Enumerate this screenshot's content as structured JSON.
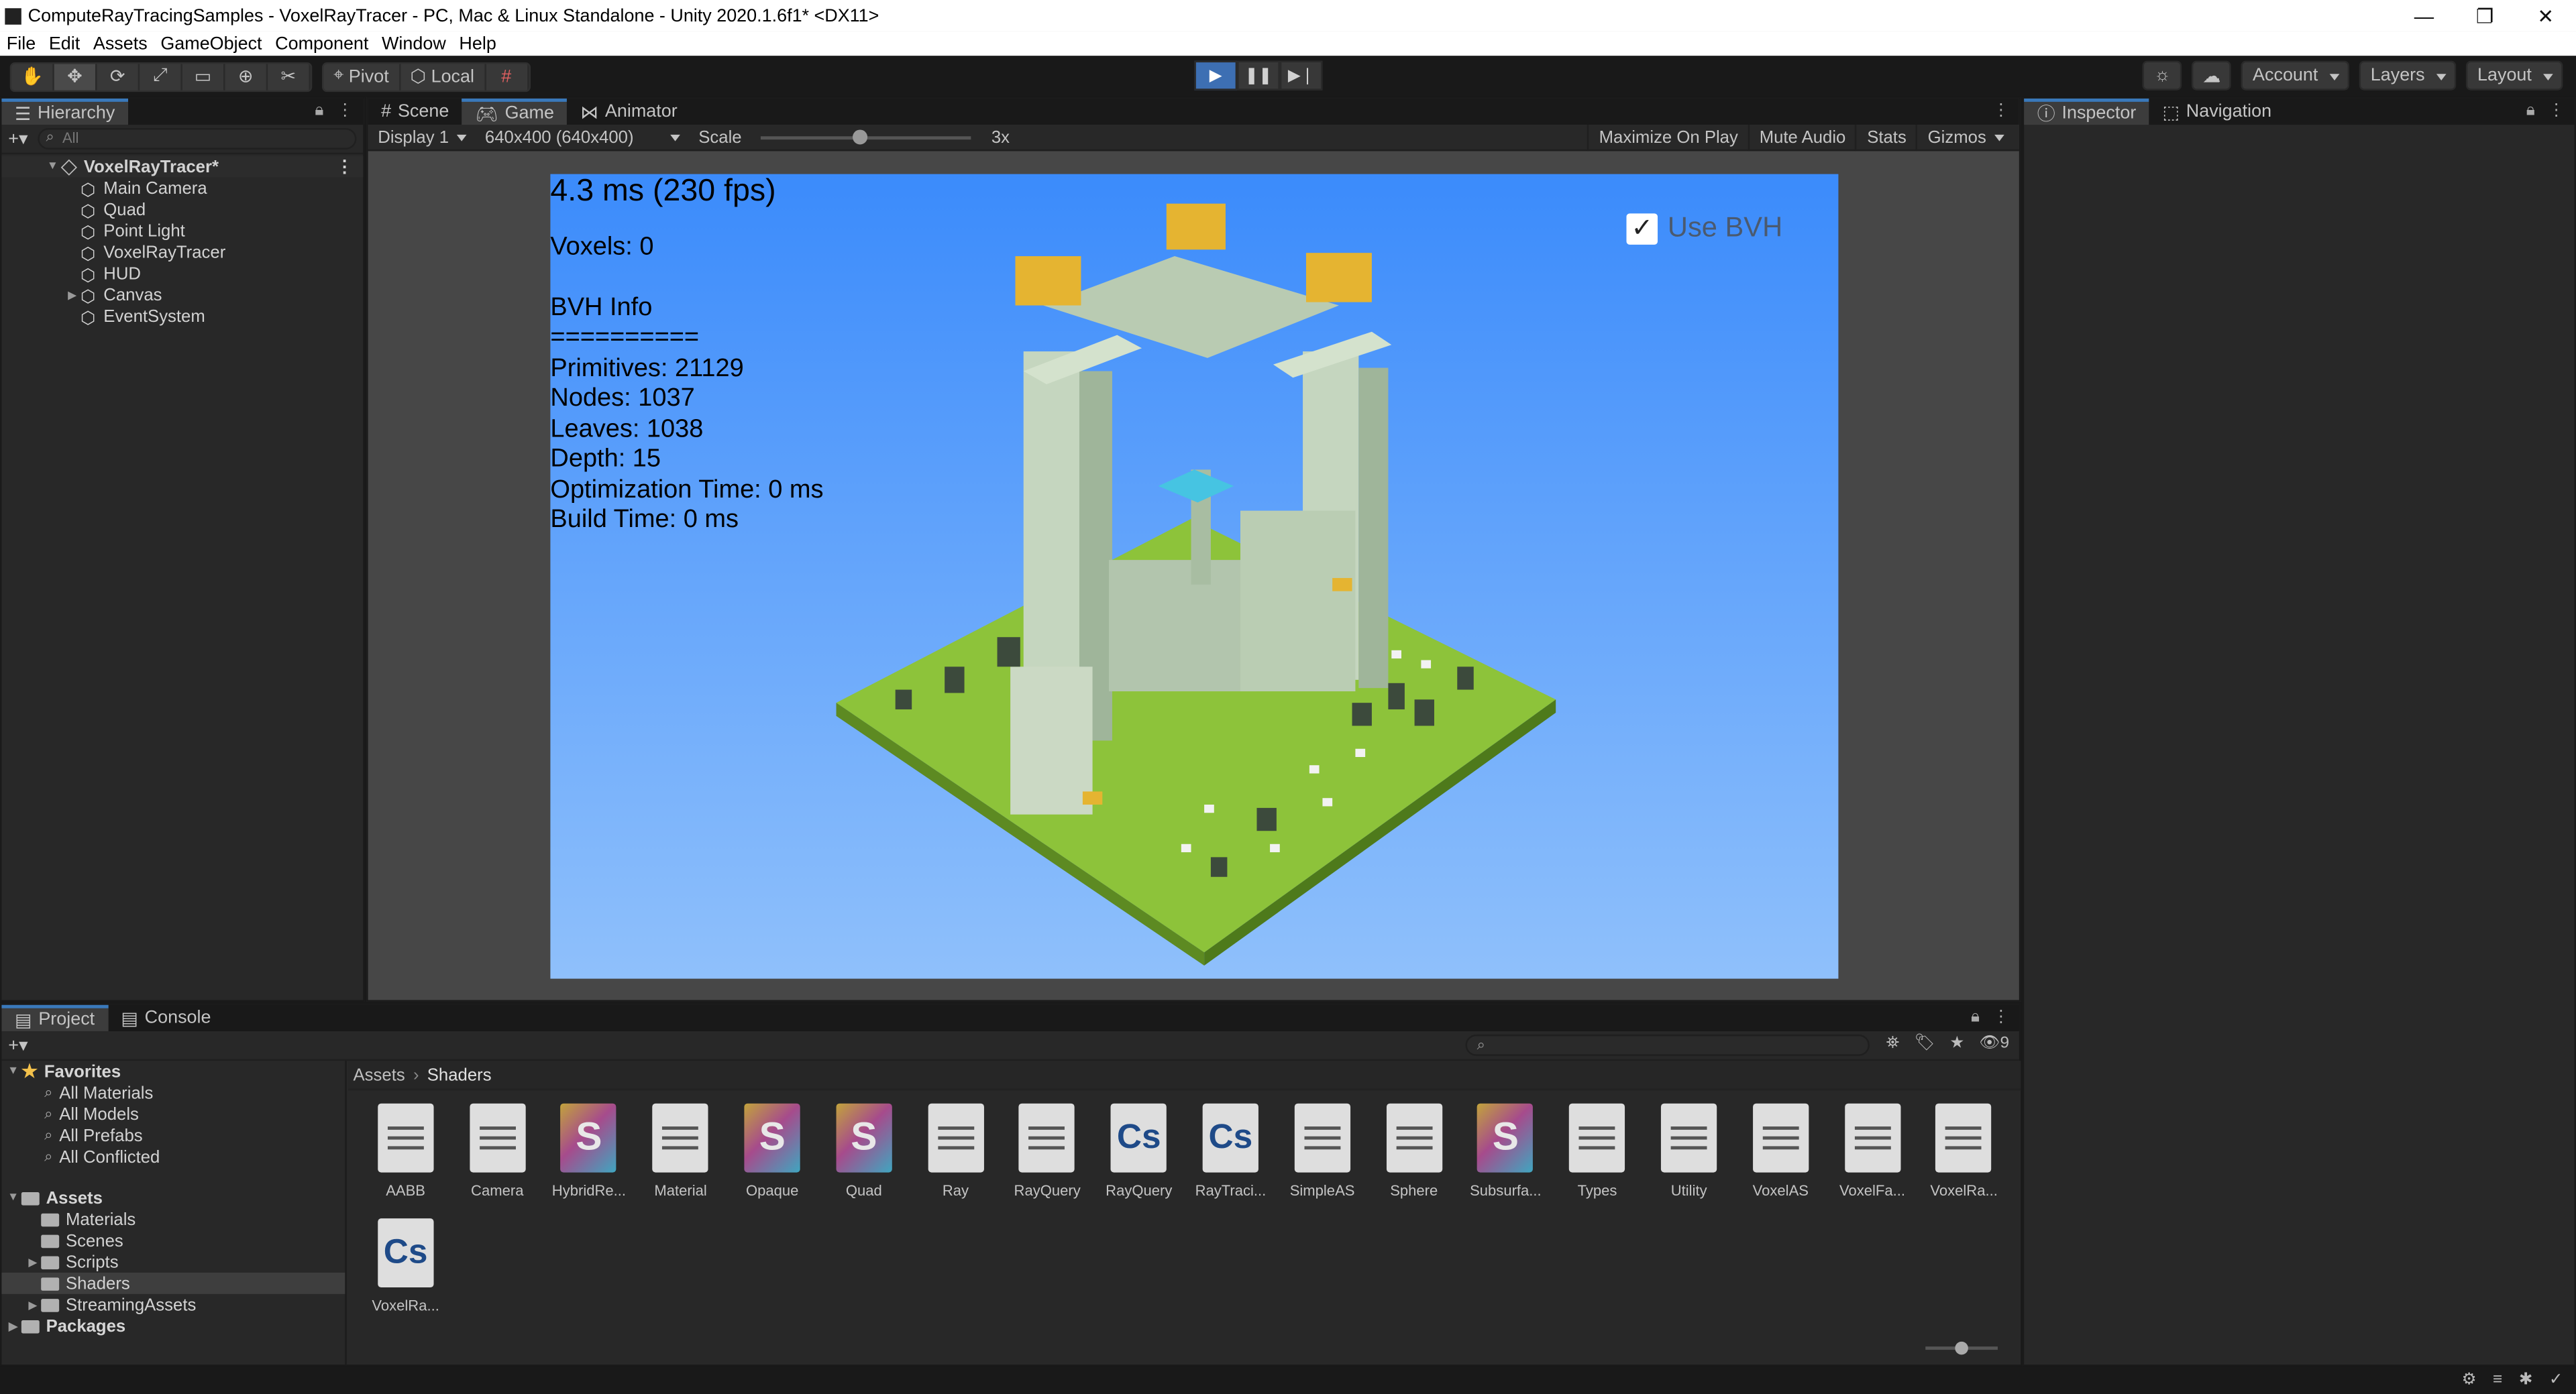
{
  "window": {
    "title": "ComputeRayTracingSamples - VoxelRayTracer - PC, Mac & Linux Standalone - Unity 2020.1.6f1* <DX11>",
    "controls": [
      "—",
      "❐",
      "✕"
    ]
  },
  "menu": [
    "File",
    "Edit",
    "Assets",
    "GameObject",
    "Component",
    "Window",
    "Help"
  ],
  "toolbar": {
    "pivot_label": "Pivot",
    "local_label": "Local",
    "account_label": "Account",
    "layers_label": "Layers",
    "layout_label": "Layout"
  },
  "hierarchy": {
    "tab_label": "Hierarchy",
    "search_placeholder": "All",
    "scene_name": "VoxelRayTracer*",
    "items": [
      "Main Camera",
      "Quad",
      "Point Light",
      "VoxelRayTracer",
      "HUD",
      "Canvas",
      "EventSystem"
    ]
  },
  "center_tabs": [
    "Scene",
    "Game",
    "Animator"
  ],
  "game_toolbar": {
    "display": "Display 1",
    "resolution": "640x400 (640x400)",
    "scale_label": "Scale",
    "scale_value": "3x",
    "maximize": "Maximize On Play",
    "mute": "Mute Audio",
    "stats": "Stats",
    "gizmos": "Gizmos"
  },
  "hud": {
    "fps": "4.3 ms (230 fps)",
    "voxels": "Voxels: 0",
    "bvh_title": "BVH Info",
    "divider": "==========",
    "primitives": "Primitives: 21129",
    "nodes": "Nodes: 1037",
    "leaves": "Leaves: 1038",
    "depth": "Depth: 15",
    "opt_time": "Optimization Time: 0 ms",
    "build_time": "Build Time: 0 ms",
    "use_bvh_label": "Use BVH",
    "use_bvh_checked": true
  },
  "right_tabs": [
    "Inspector",
    "Navigation"
  ],
  "bottom_tabs": [
    "Project",
    "Console"
  ],
  "project": {
    "hidden_count": "9",
    "favorites_label": "Favorites",
    "favorites": [
      "All Materials",
      "All Models",
      "All Prefabs",
      "All Conflicted"
    ],
    "assets_label": "Assets",
    "asset_folders": [
      "Materials",
      "Scenes",
      "Scripts",
      "Shaders",
      "StreamingAssets"
    ],
    "packages_label": "Packages",
    "breadcrumb": [
      "Assets",
      "Shaders"
    ],
    "files": [
      {
        "name": "AABB",
        "kind": "doc"
      },
      {
        "name": "Camera",
        "kind": "doc"
      },
      {
        "name": "HybridRe...",
        "kind": "shader"
      },
      {
        "name": "Material",
        "kind": "doc"
      },
      {
        "name": "Opaque",
        "kind": "shader"
      },
      {
        "name": "Quad",
        "kind": "shader"
      },
      {
        "name": "Ray",
        "kind": "doc"
      },
      {
        "name": "RayQuery",
        "kind": "doc"
      },
      {
        "name": "RayQuery",
        "kind": "cs"
      },
      {
        "name": "RayTraci...",
        "kind": "cs"
      },
      {
        "name": "SimpleAS",
        "kind": "doc"
      },
      {
        "name": "Sphere",
        "kind": "doc"
      },
      {
        "name": "Subsurfa...",
        "kind": "shader"
      },
      {
        "name": "Types",
        "kind": "doc"
      },
      {
        "name": "Utility",
        "kind": "doc"
      },
      {
        "name": "VoxelAS",
        "kind": "doc"
      },
      {
        "name": "VoxelFa...",
        "kind": "doc"
      },
      {
        "name": "VoxelRa...",
        "kind": "doc"
      },
      {
        "name": "VoxelRa...",
        "kind": "cs"
      }
    ]
  },
  "colors": {
    "accent": "#3a79bb",
    "sky_top": "#3b8bfb",
    "sky_bottom": "#8fc0fb",
    "grass": "#8dc33a"
  }
}
